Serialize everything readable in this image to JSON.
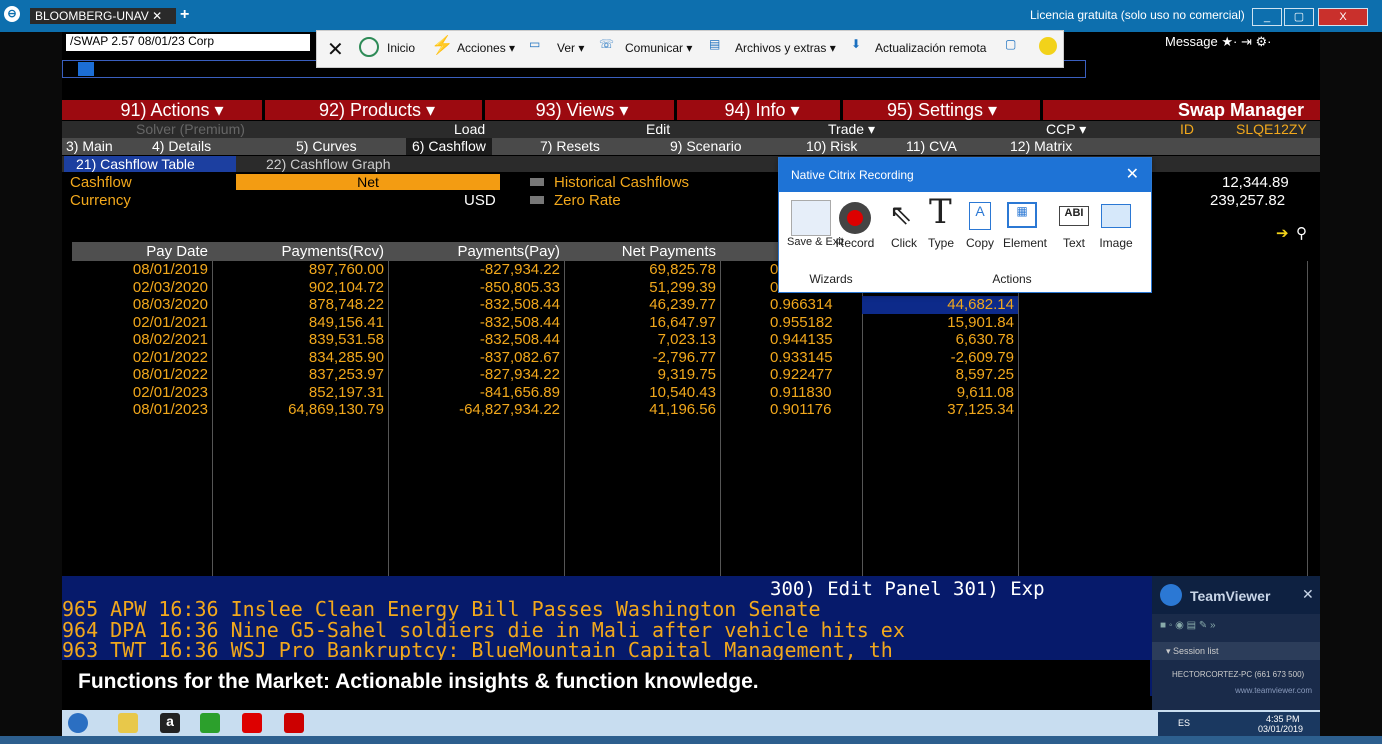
{
  "window": {
    "tab_label": "BLOOMBERG-UNAV",
    "tab_close": "✕",
    "add_tab": "+",
    "license": "Licencia gratuita (solo uso no comercial)",
    "btn_min": "_",
    "btn_max": "▢",
    "btn_close": "X"
  },
  "security_box": "/SWAP 2.57 08/01/23 Corp",
  "nav": {
    "back": "<",
    "fwd": ">"
  },
  "message_bar": "Message  ★·  ⇥  ⚙·",
  "citrix_toolbar": {
    "inicio": "Inicio",
    "acciones": "Acciones ▾",
    "ver": "Ver ▾",
    "comunicar": "Comunicar ▾",
    "archivos": "Archivos y extras ▾",
    "actualizacion": "Actualización remota"
  },
  "menu": {
    "actions": "91) Actions ▾",
    "products": "92) Products ▾",
    "views": "93) Views ▾",
    "info": "94) Info ▾",
    "settings": "95) Settings ▾",
    "title": "Swap Manager"
  },
  "row2": {
    "solver": "Solver (Premium)",
    "load": "Load",
    "edit": "Edit",
    "trade": "Trade ▾",
    "ccp": "CCP ▾",
    "id_label": "ID",
    "id_value": "SLQE12ZY"
  },
  "tabs": [
    "3) Main",
    "4) Details",
    "5) Curves",
    "6) Cashflow",
    "7) Resets",
    "9) Scenario",
    "10) Risk",
    "11) CVA",
    "12) Matrix"
  ],
  "subtabs": {
    "table": "21) Cashflow Table",
    "graph": "22) Cashflow Graph"
  },
  "fields": {
    "cashflow_label": "Cashflow",
    "cashflow_value": "Net",
    "currency_label": "Currency",
    "currency_value": "USD",
    "hist": "Historical Cashflows",
    "zero": "Zero Rate",
    "right_val1": "12,344.89",
    "right_val2": "239,257.82"
  },
  "table": {
    "headers": [
      "Pay Date",
      "Payments(Rcv)",
      "Payments(Pay)",
      "Net Payments",
      "D",
      "",
      ""
    ],
    "rows": [
      [
        "08/01/2019",
        "897,760.00",
        "-827,934.22",
        "69,825.78",
        "0",
        ""
      ],
      [
        "02/03/2020",
        "902,104.72",
        "-850,805.33",
        "51,299.39",
        "0",
        ""
      ],
      [
        "08/03/2020",
        "878,748.22",
        "-832,508.44",
        "46,239.77",
        "0.966314",
        "44,682.14"
      ],
      [
        "02/01/2021",
        "849,156.41",
        "-832,508.44",
        "16,647.97",
        "0.955182",
        "15,901.84"
      ],
      [
        "08/02/2021",
        "839,531.58",
        "-832,508.44",
        "7,023.13",
        "0.944135",
        "6,630.78"
      ],
      [
        "02/01/2022",
        "834,285.90",
        "-837,082.67",
        "-2,796.77",
        "0.933145",
        "-2,609.79"
      ],
      [
        "08/01/2022",
        "837,253.97",
        "-827,934.22",
        "9,319.75",
        "0.922477",
        "8,597.25"
      ],
      [
        "02/01/2023",
        "852,197.31",
        "-841,656.89",
        "10,540.43",
        "0.911830",
        "9,611.08"
      ],
      [
        "08/01/2023",
        "64,869,130.79",
        "-64,827,934.22",
        "41,196.56",
        "0.901176",
        "37,125.34"
      ]
    ]
  },
  "editpanel": "300) Edit Panel  301) Exp",
  "news": [
    "965 APW 16:36 Inslee Clean Energy Bill Passes Washington Senate",
    "964 DPA 16:36 Nine G5-Sahel soldiers die in Mali after vehicle hits ex",
    "963 TWT 16:36 WSJ Pro Bankruptcy: BlueMountain Capital Management, th"
  ],
  "functions_banner": "Functions for the Market: Actionable insights & function knowledge.",
  "citrix_panel": {
    "title": "Native Citrix Recording",
    "close": "✕",
    "save": "Save & Exit",
    "record": "Record",
    "click": "Click",
    "type": "Type",
    "copy": "Copy",
    "element": "Element",
    "text": "Text",
    "image": "Image",
    "wizards": "Wizards",
    "actions": "Actions"
  },
  "teamviewer": {
    "title": "TeamViewer",
    "session": "▾ Session list",
    "host": "HECTORCORTEZ-PC (661 673 500)",
    "footer": "www.teamviewer.com"
  },
  "tray": {
    "lang": "ES",
    "time": "4:35 PM",
    "date": "03/01/2019"
  }
}
